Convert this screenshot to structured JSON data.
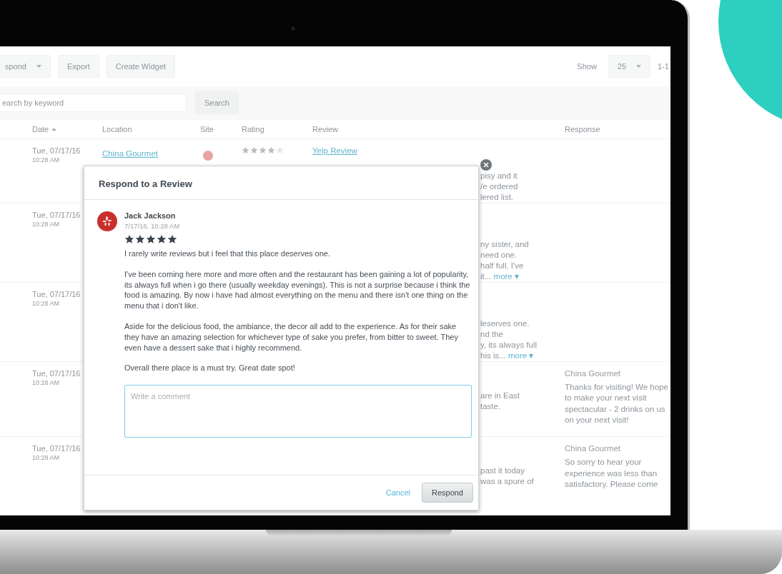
{
  "toolbar": {
    "filter_select": "spond",
    "buttons": [
      "Export",
      "Create Widget"
    ],
    "show_label": "Show",
    "page_size": "25",
    "range": "1-1"
  },
  "search": {
    "placeholder": "earch by keyword",
    "button": "Search"
  },
  "table": {
    "columns": [
      {
        "label": "Date",
        "sorted": true
      },
      {
        "label": "Location",
        "sorted": false
      },
      {
        "label": "Site",
        "sorted": false
      },
      {
        "label": "Rating",
        "sorted": false
      },
      {
        "label": "Review",
        "sorted": false
      },
      {
        "label": "Response",
        "sorted": false
      }
    ],
    "rows": [
      {
        "date": "Tue, 07/17/16",
        "time": "10:28 AM",
        "location": "China Gourmet",
        "site_icon": true,
        "stars": 4,
        "review_link": "Yelp Review",
        "review_lines": [
          "pisy and it",
          "/e ordered",
          "lered list."
        ]
      },
      {
        "date": "Tue, 07/17/16",
        "time": "10:28 AM",
        "review_lines": [
          "ny sister, and",
          "need one.",
          "half full. I've",
          "it..."
        ],
        "more": "more ▾"
      },
      {
        "date": "Tue, 07/17/16",
        "time": "10:28 AM",
        "review_lines": [
          "leserves one.",
          "nd the",
          "y, its always full",
          "his is..."
        ],
        "more": "more ▾"
      },
      {
        "date": "Tue, 07/17/16",
        "time": "10:28 AM",
        "review_lines": [
          "are in East",
          "taste."
        ],
        "response": {
          "author": "China Gourmet",
          "text": "Thanks for visiting! We hope to make your next visit spectacular - 2 drinks on us on your next visit!"
        }
      },
      {
        "date": "Tue, 07/17/16",
        "time": "10:28 AM",
        "review_lines": [
          "past it today",
          "was a spure of"
        ],
        "response": {
          "author": "China Gourmet",
          "text": "So sorry to hear your experience was less than satisfactory. Please come"
        }
      }
    ]
  },
  "modal": {
    "title": "Respond to a Review",
    "reviewer": "Jack Jackson",
    "date": "7/17/16, 10:28 AM",
    "stars": 5,
    "paragraphs": [
      "I rarely write reviews but i feel that this place deserves one.",
      "I've been coming here more and more often and the restaurant has been gaining  a lot of popularity, its always full when i go there (usually weekday evenings). This is not a surprise because i think the food is amazing. By now i have had almost everything on the menu and there isn't one thing on the menu that i don't like.",
      "Aside for the delicious food, the ambiance, the decor all add to the experience. As for their sake they have an amazing selection for whichever type of sake you prefer, from bitter to sweet. They even have a dessert sake that i highly recommend.",
      "Overall there place is a must try. Great date spot!"
    ],
    "comment_placeholder": "Write a comment",
    "cancel": "Cancel",
    "submit": "Respond"
  }
}
